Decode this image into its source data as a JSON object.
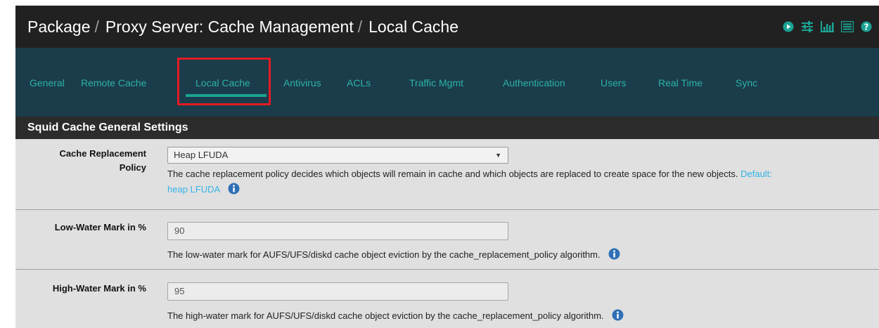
{
  "header": {
    "crumbs": [
      "Package",
      "Proxy Server: Cache Management",
      "Local Cache"
    ],
    "separator": "/",
    "icons": [
      "play-circle-icon",
      "sliders-icon",
      "bar-chart-icon",
      "list-icon",
      "help-icon"
    ]
  },
  "tabs": [
    {
      "label": "General"
    },
    {
      "label": "Remote Cache"
    },
    {
      "label": "Local Cache",
      "active": true
    },
    {
      "label": "Antivirus"
    },
    {
      "label": "ACLs"
    },
    {
      "label": "Traffic Mgmt"
    },
    {
      "label": "Authentication"
    },
    {
      "label": "Users"
    },
    {
      "label": "Real Time"
    },
    {
      "label": "Sync"
    }
  ],
  "section": {
    "title": "Squid Cache General Settings",
    "fields": {
      "policy": {
        "label_line1": "Cache Replacement",
        "label_line2": "Policy",
        "value": "Heap LFUDA",
        "help": "The cache replacement policy decides which objects will remain in cache and which objects are replaced to create space for the new objects.",
        "default_line1": "Default:",
        "default_line2": "heap LFUDA"
      },
      "low": {
        "label": "Low-Water Mark in %",
        "value": "90",
        "help": "The low-water mark for AUFS/UFS/diskd cache object eviction by the cache_replacement_policy algorithm."
      },
      "high": {
        "label": "High-Water Mark in %",
        "value": "95",
        "help": "The high-water mark for AUFS/UFS/diskd cache object eviction by the cache_replacement_policy algorithm."
      }
    }
  },
  "colors": {
    "accent": "#1aa394",
    "tab_text": "#2bb3a6",
    "highlight": "#e41b23",
    "info": "#2f6fb6",
    "default_text": "#33b3e6"
  }
}
